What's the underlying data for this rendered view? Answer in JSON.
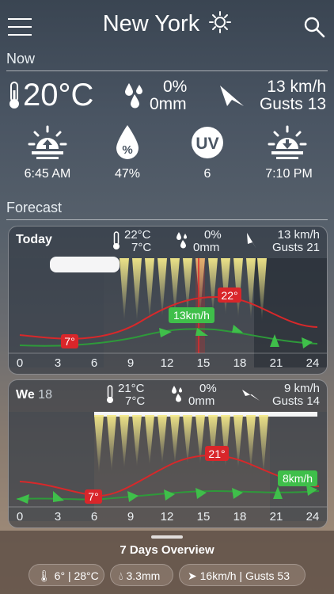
{
  "header": {
    "city": "New York"
  },
  "now": {
    "label": "Now",
    "temperature": "20°C",
    "precip_pct": "0%",
    "precip_mm": "0mm",
    "wind": "13 km/h",
    "gusts": "Gusts 13",
    "sunrise": "6:45 AM",
    "humidity": "47%",
    "uv_value": "6",
    "uv_badge": "UV",
    "sunset": "7:10 PM"
  },
  "forecast": {
    "label": "Forecast",
    "days": [
      {
        "day": "Today",
        "date": "",
        "temp_max": "22°C",
        "temp_min": "7°C",
        "precip_pct": "0%",
        "precip_mm": "0mm",
        "wind": "13 km/h",
        "gusts": "Gusts 21",
        "hours": [
          "0",
          "3",
          "6",
          "9",
          "12",
          "15",
          "18",
          "21",
          "24"
        ],
        "min_label": "7°",
        "max_label": "22°",
        "wind_label": "13km/h"
      },
      {
        "day": "We",
        "date": "18",
        "temp_max": "21°C",
        "temp_min": "7°C",
        "precip_pct": "0%",
        "precip_mm": "0mm",
        "wind": "9 km/h",
        "gusts": "Gusts 14",
        "hours": [
          "0",
          "3",
          "6",
          "9",
          "12",
          "15",
          "18",
          "21",
          "24"
        ],
        "min_label": "7°",
        "max_label": "21°",
        "wind_label": "8km/h"
      }
    ]
  },
  "overview": {
    "title": "7 Days Overview",
    "temp_range": "6° | 28°C",
    "precip": "3.3mm",
    "wind": "16km/h | Gusts 53"
  },
  "colors": {
    "temp_line": "#d8282a",
    "wind_line": "#2e9a3a",
    "wind_label_bg": "#3fbf4a",
    "temp_label_bg": "#d9262a"
  }
}
